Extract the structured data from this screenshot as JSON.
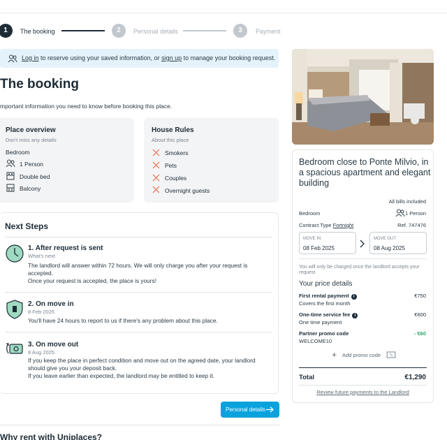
{
  "stepper": {
    "steps": [
      {
        "number": "1",
        "label": "The booking"
      },
      {
        "number": "2",
        "label": "Personal details"
      },
      {
        "number": "3",
        "label": "Payment"
      }
    ]
  },
  "login_banner": {
    "login_link": "Log in",
    "text_mid": " to reserve using your saved information, or ",
    "signup_link": "sign up",
    "text_end": " to manage your booking request."
  },
  "page_title": "The booking",
  "intro": "mportant information you need to know before booking this place.",
  "place_overview": {
    "title": "Place overview",
    "subtitle": "Don't miss any details",
    "items": [
      "Bedroom",
      "1 Person",
      "Double bed",
      "Balcony"
    ]
  },
  "house_rules": {
    "title": "House Rules",
    "subtitle": "About this place",
    "items": [
      "Smokers",
      "Pets",
      "Couples",
      "Overnight guests"
    ]
  },
  "next_steps": {
    "title": "Next Steps",
    "steps": [
      {
        "title": "1. After request is sent",
        "sub": "What's next",
        "body_1": "The landlord will answer within 72 hours. We will only charge you after your request is accepted.",
        "body_2": "Once your request is accepted, the place is yours!"
      },
      {
        "title": "2. On move in",
        "sub": "8 Feb 2025",
        "body_1": "You'll have 24 hours to report to us if there's any problem about this place."
      },
      {
        "title": "3. On move out",
        "sub": "8 Aug 2025",
        "body_1": "If you keep the place in perfect condition and move out on the agreed date, your landlord should give you your deposit back.",
        "body_2": "If you leave earlier than expected, the landlord may be entitled to keep it."
      }
    ]
  },
  "cta_label": "Personal details",
  "why_title": "Why rent with Uniplaces?",
  "booking_card": {
    "room_title": "Bedroom close to Ponte Milvio, in a spacious apartment and elegant building",
    "bills": "All bills included",
    "room_type": "Bedroom",
    "persons": "1 Person",
    "contract_label": "Contract Type",
    "contract_value": "Fortnight",
    "reference": "Ref. 747476",
    "move_in_label": "MOVE IN",
    "move_in_date": "08 Feb 2025",
    "move_out_label": "MOVE OUT",
    "move_out_date": "08 Aug 2025",
    "charge_note": "You will only be charged once the landlord accepts your request",
    "price_details_title": "Your price details",
    "line_items": [
      {
        "title": "First rental payment",
        "sub": "Covers the first month",
        "amount": "€750"
      },
      {
        "title": "One-time service fee",
        "sub": "One time payment",
        "amount": "€600"
      },
      {
        "title": "Partner promo code",
        "sub": "WELCOME10",
        "amount": "- €60"
      }
    ],
    "add_promo": "Add promo code",
    "total_label": "Total",
    "total_amount": "€1,290",
    "review_link": "Review future payments to the Landlord"
  },
  "colors": {
    "accent": "#0aa2dd",
    "dark": "#1d2b36",
    "muted": "#c2c8cd",
    "rule_x": "#e8846c",
    "discount": "#2fa66a",
    "banner_bg": "#e4f3fb",
    "card_bg": "#f3f4f5"
  }
}
